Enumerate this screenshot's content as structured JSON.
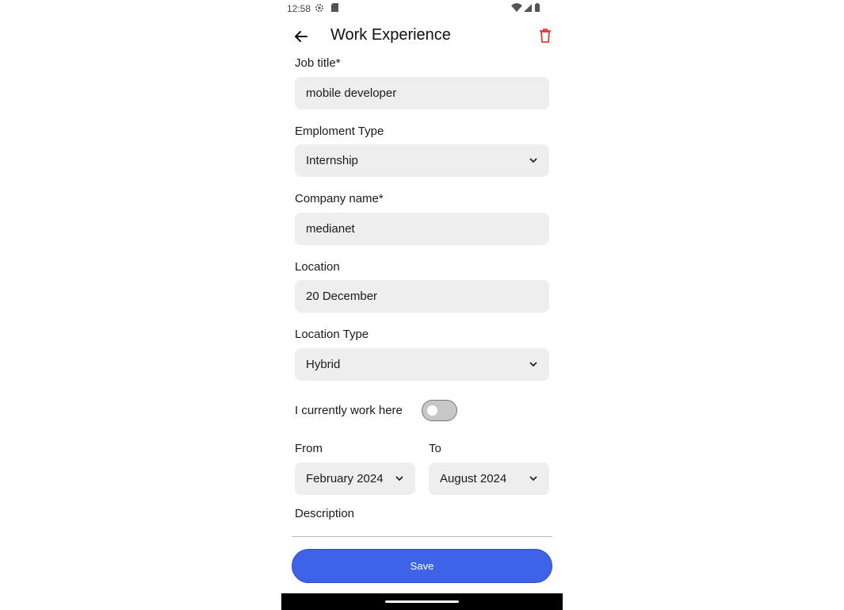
{
  "status_bar": {
    "time": "12:58"
  },
  "app_bar": {
    "title": "Work Experience"
  },
  "form": {
    "job_title": {
      "label": "Job title*",
      "value": "mobile developer"
    },
    "employment_type": {
      "label": "Emploment Type",
      "value": "Internship"
    },
    "company_name": {
      "label": "Company name*",
      "value": "medianet"
    },
    "location": {
      "label": "Location",
      "value": "20 December"
    },
    "location_type": {
      "label": "Location Type",
      "value": "Hybrid"
    },
    "current_work": {
      "label": "I currently work here",
      "checked": false
    },
    "from": {
      "label": "From",
      "value": "February 2024"
    },
    "to": {
      "label": "To",
      "value": "August 2024"
    },
    "description": {
      "label": "Description",
      "value": ""
    }
  },
  "actions": {
    "save_label": "Save"
  },
  "colors": {
    "primary": "#3f63e8",
    "delete": "#e53935",
    "field_bg": "#eeeeee"
  },
  "icons": [
    "settings-icon",
    "sim-card-icon",
    "wifi-icon",
    "signal-icon",
    "battery-icon",
    "back-arrow-icon",
    "trash-icon",
    "chevron-down-icon"
  ]
}
